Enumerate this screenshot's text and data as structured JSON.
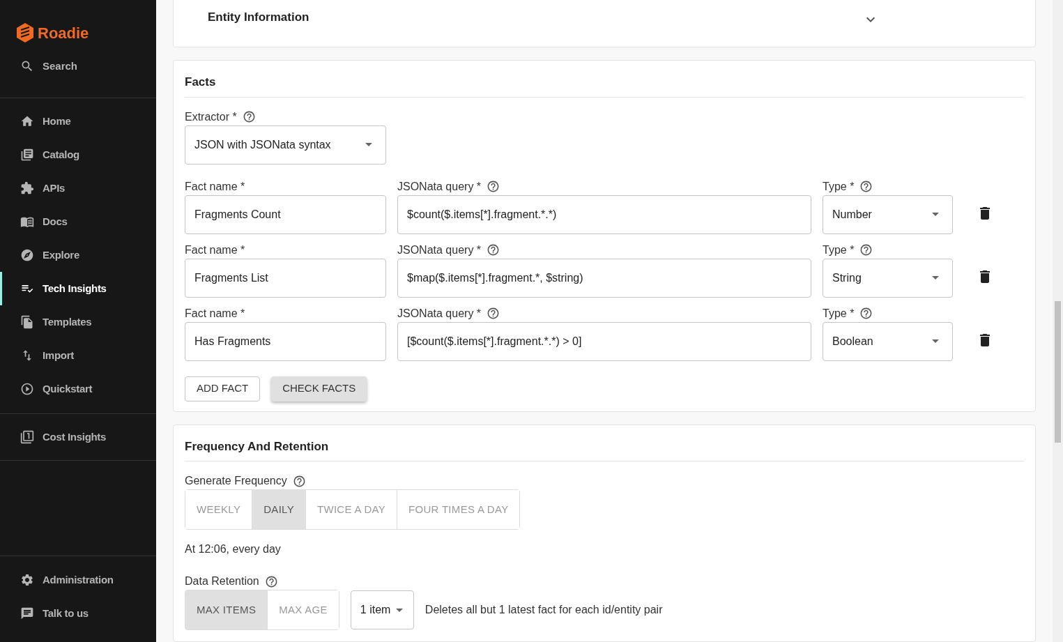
{
  "sidebar": {
    "logo": "Roadie",
    "search": "Search",
    "main_items": [
      {
        "label": "Home",
        "selected": false
      },
      {
        "label": "Catalog",
        "selected": false
      },
      {
        "label": "APIs",
        "selected": false
      },
      {
        "label": "Docs",
        "selected": false
      },
      {
        "label": "Explore",
        "selected": false
      },
      {
        "label": "Tech Insights",
        "selected": true
      },
      {
        "label": "Templates",
        "selected": false
      },
      {
        "label": "Import",
        "selected": false
      },
      {
        "label": "Quickstart",
        "selected": false
      }
    ],
    "plugin_items": [
      {
        "label": "Cost Insights",
        "selected": false
      }
    ],
    "bottom_items": [
      {
        "label": "Administration",
        "selected": false
      },
      {
        "label": "Talk to us",
        "selected": false
      }
    ]
  },
  "entity_section": {
    "title": "Entity Information"
  },
  "facts": {
    "title": "Facts",
    "extractor": {
      "label": "Extractor *",
      "value": "JSON with JSONata syntax"
    },
    "rows": [
      {
        "name_label": "Fact name *",
        "name": "Fragments Count",
        "query_label": "JSONata query *",
        "query": "$count($.items[*].fragment.*.*)",
        "type_label": "Type *",
        "type": "Number"
      },
      {
        "name_label": "Fact name *",
        "name": "Fragments List",
        "query_label": "JSONata query *",
        "query": "$map($.items[*].fragment.*, $string)",
        "type_label": "Type *",
        "type": "String"
      },
      {
        "name_label": "Fact name *",
        "name": "Has Fragments",
        "query_label": "JSONata query *",
        "query": "[$count($.items[*].fragment.*.*) > 0]",
        "type_label": "Type *",
        "type": "Boolean"
      }
    ],
    "buttons": [
      {
        "label": "ADD FACT",
        "kind": "outlined"
      },
      {
        "label": "CHECK FACTS",
        "kind": "contained"
      }
    ]
  },
  "frequency": {
    "title": "Frequency And Retention",
    "generate_label": "Generate Frequency",
    "options": [
      {
        "label": "WEEKLY",
        "selected": false
      },
      {
        "label": "DAILY",
        "selected": true
      },
      {
        "label": "TWICE A DAY",
        "selected": false
      },
      {
        "label": "FOUR TIMES A DAY",
        "selected": false
      }
    ],
    "schedule": "At 12:06, every day",
    "retention_label": "Data Retention",
    "retention_options": [
      {
        "label": "MAX ITEMS",
        "selected": true
      },
      {
        "label": "MAX AGE",
        "selected": false
      }
    ],
    "retention_count": "1 item",
    "retention_description": "Deletes all but 1 latest fact for each id/entity pair"
  }
}
